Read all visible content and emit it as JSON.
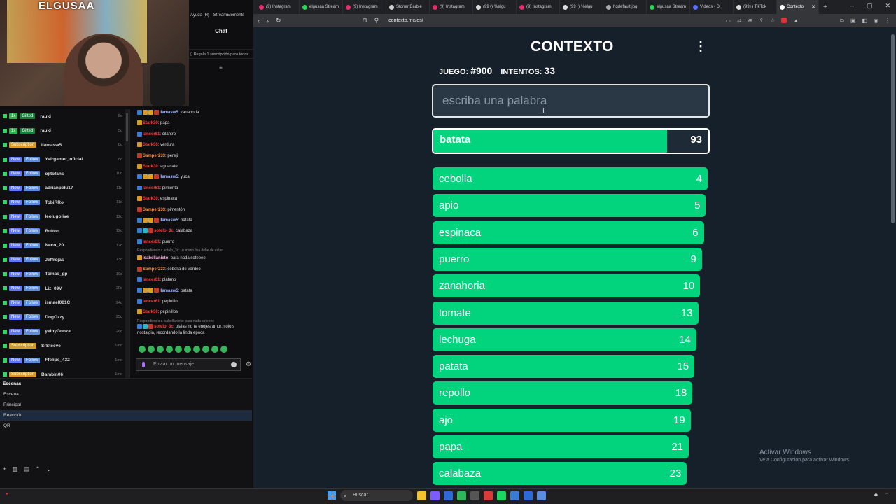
{
  "studio": {
    "webcam_banner": "ELGUSAA",
    "top_menu": [
      "Ayuda (H)",
      "StreamElements"
    ],
    "chat_title": "Chat",
    "gift_note": "Regala 1 suscripción para todos",
    "activity": [
      {
        "badges": [
          [
            "1x",
            "gifted"
          ],
          [
            "Gifted",
            "gift2"
          ]
        ],
        "user": "rauki",
        "ago": "5d"
      },
      {
        "badges": [
          [
            "1x",
            "gifted"
          ],
          [
            "Gifted",
            "gift2"
          ]
        ],
        "user": "rauki",
        "ago": "5d"
      },
      {
        "badges": [
          [
            "Subscription",
            "sub"
          ]
        ],
        "user": "llamasw5",
        "ago": "8d"
      },
      {
        "badges": [
          [
            "New",
            "new"
          ],
          [
            "Follow",
            "follow"
          ]
        ],
        "user": "Yairgamer_oficial",
        "ago": "8d"
      },
      {
        "badges": [
          [
            "New",
            "new"
          ],
          [
            "Follow",
            "follow"
          ]
        ],
        "user": "ojitofans",
        "ago": "10d"
      },
      {
        "badges": [
          [
            "New",
            "new"
          ],
          [
            "Follow",
            "follow"
          ]
        ],
        "user": "adrianpelu17",
        "ago": "11d"
      },
      {
        "badges": [
          [
            "New",
            "new"
          ],
          [
            "Follow",
            "follow"
          ]
        ],
        "user": "TobiRRo",
        "ago": "11d"
      },
      {
        "badges": [
          [
            "New",
            "new"
          ],
          [
            "Follow",
            "follow"
          ]
        ],
        "user": "leolugolive",
        "ago": "12d"
      },
      {
        "badges": [
          [
            "New",
            "new"
          ],
          [
            "Follow",
            "follow"
          ]
        ],
        "user": "Bultoo",
        "ago": "12d"
      },
      {
        "badges": [
          [
            "New",
            "new"
          ],
          [
            "Follow",
            "follow"
          ]
        ],
        "user": "Neco_20",
        "ago": "12d"
      },
      {
        "badges": [
          [
            "New",
            "new"
          ],
          [
            "Follow",
            "follow"
          ]
        ],
        "user": "Jeffrojas",
        "ago": "13d"
      },
      {
        "badges": [
          [
            "New",
            "new"
          ],
          [
            "Follow",
            "follow"
          ]
        ],
        "user": "Tomas_gp",
        "ago": "19d"
      },
      {
        "badges": [
          [
            "New",
            "new"
          ],
          [
            "Follow",
            "follow"
          ]
        ],
        "user": "Liz_09V",
        "ago": "20d"
      },
      {
        "badges": [
          [
            "New",
            "new"
          ],
          [
            "Follow",
            "follow"
          ]
        ],
        "user": "ismael001C",
        "ago": "24d"
      },
      {
        "badges": [
          [
            "New",
            "new"
          ],
          [
            "Follow",
            "follow"
          ]
        ],
        "user": "DogOzzy",
        "ago": "25d"
      },
      {
        "badges": [
          [
            "New",
            "new"
          ],
          [
            "Follow",
            "follow"
          ]
        ],
        "user": "yeinyGonza",
        "ago": "26d"
      },
      {
        "badges": [
          [
            "Subscription",
            "sub"
          ]
        ],
        "user": "SrSteeve",
        "ago": "1mo"
      },
      {
        "badges": [
          [
            "New",
            "new"
          ],
          [
            "Follow",
            "follow"
          ]
        ],
        "user": "Ffelipe_432",
        "ago": "1mo"
      },
      {
        "badges": [
          [
            "Subscription",
            "sub"
          ]
        ],
        "user": "Bambin06",
        "ago": "1mo"
      }
    ],
    "chat": [
      {
        "user": "llamasw5",
        "color": "#9fb3ff",
        "text": "zanahoria",
        "badges": [
          "#3a7bd5",
          "#d79a25",
          "#e0a020",
          "#c0392b"
        ]
      },
      {
        "user": "Stark30",
        "color": "#ff3b3b",
        "text": "papa",
        "badges": [
          "#d79a25"
        ]
      },
      {
        "user": "lancer61",
        "color": "#ff3b3b",
        "text": "cilantro",
        "badges": [
          "#3a7bd5"
        ]
      },
      {
        "user": "Stark30",
        "color": "#ff3b3b",
        "text": "verdura",
        "badges": [
          "#d79a25"
        ]
      },
      {
        "user": "Samper233",
        "color": "#ff8c3b",
        "text": "perejil",
        "badges": [
          "#c0392b"
        ]
      },
      {
        "user": "Stark30",
        "color": "#ff3b3b",
        "text": "aguacate",
        "badges": [
          "#d79a25"
        ]
      },
      {
        "user": "llamasw5",
        "color": "#9fb3ff",
        "text": "yuca",
        "badges": [
          "#3a7bd5",
          "#d79a25",
          "#e0a020",
          "#c0392b"
        ]
      },
      {
        "user": "lancer61",
        "color": "#ff3b3b",
        "text": "pimienta",
        "badges": [
          "#3a7bd5"
        ]
      },
      {
        "user": "Stark30",
        "color": "#ff3b3b",
        "text": "espinaca",
        "badges": [
          "#d79a25"
        ]
      },
      {
        "user": "Samper233",
        "color": "#ff8c3b",
        "text": "pimentón",
        "badges": [
          "#c0392b"
        ]
      },
      {
        "user": "llamasw5",
        "color": "#9fb3ff",
        "text": "batata",
        "badges": [
          "#3a7bd5",
          "#d79a25",
          "#e0a020",
          "#c0392b"
        ]
      },
      {
        "user": "sotelo_3c",
        "color": "#ff3b3b",
        "text": "calabaza",
        "badges": [
          "#3a7bd5",
          "#2fb6c5",
          "#c0392b"
        ]
      },
      {
        "user": "lancer61",
        "color": "#ff3b3b",
        "text": "puerro",
        "badges": [
          "#3a7bd5"
        ]
      },
      {
        "reply": "Respondiendo a sotelo_3c: uy mano lisa debe de estar"
      },
      {
        "user": "isabellanieto",
        "color": "#ffb0e0",
        "text": "para nada soteeee",
        "badges": [
          "#e0a020"
        ]
      },
      {
        "user": "Samper233",
        "color": "#ff8c3b",
        "text": "cebolla de verdeo",
        "badges": [
          "#c0392b"
        ]
      },
      {
        "user": "lancer61",
        "color": "#ff3b3b",
        "text": "plátano",
        "badges": [
          "#3a7bd5"
        ]
      },
      {
        "user": "llamasw5",
        "color": "#9fb3ff",
        "text": "batata",
        "badges": [
          "#3a7bd5",
          "#d79a25",
          "#e0a020",
          "#c0392b"
        ]
      },
      {
        "user": "lancer61",
        "color": "#ff3b3b",
        "text": "pepinillo",
        "badges": [
          "#3a7bd5"
        ]
      },
      {
        "user": "Stark30",
        "color": "#ff3b3b",
        "text": "pepinillos",
        "badges": [
          "#d79a25"
        ]
      },
      {
        "reply": "Respondiendo a isabellanieto: para nada soteeee"
      },
      {
        "user": "sotelo_3c",
        "color": "#ff3b3b",
        "text": "ojalas no te enojes amor, solo s nostalgia, recordando la linda epoca",
        "badges": [
          "#3a7bd5",
          "#2fb6c5",
          "#c0392b"
        ],
        "wrap": true
      }
    ],
    "chat_input_placeholder": "Enviar un mensaje",
    "scenes_title": "Escenas",
    "scenes": [
      "Escena",
      "Principal",
      "Reacción",
      "QR"
    ],
    "active_scene": "Reacción"
  },
  "browser": {
    "tabs": [
      {
        "label": "(9) Instagram",
        "color": "#e1306c"
      },
      {
        "label": "elgusaa Stream",
        "color": "#2fd35a"
      },
      {
        "label": "(9) Instagram",
        "color": "#e1306c"
      },
      {
        "label": "Stoner Barbie",
        "color": "#cccccc"
      },
      {
        "label": "(9) Instagram",
        "color": "#e1306c"
      },
      {
        "label": "(99+) %elgu",
        "color": "#dddddd"
      },
      {
        "label": "(9) Instagram",
        "color": "#e1306c"
      },
      {
        "label": "(99+) %elgu",
        "color": "#dddddd"
      },
      {
        "label": "hqdefault.jpg",
        "color": "#aaaaaa"
      },
      {
        "label": "elgusaa Stream",
        "color": "#2fd35a"
      },
      {
        "label": "Videos • D",
        "color": "#5a6cff"
      },
      {
        "label": "(99+) TikTok",
        "color": "#dddddd"
      },
      {
        "label": "Contexto",
        "color": "#ffffff",
        "active": true
      }
    ],
    "url": "contexto.me/es/"
  },
  "game": {
    "logo": "CONTEXTO",
    "game_label": "JUEGO:",
    "game_number": "#900",
    "attempts_label": "INTENTOS:",
    "attempts": "33",
    "input_placeholder": "escriba una palabra",
    "last_guess": {
      "word": "batata",
      "rank": 93,
      "fill": 0.85
    },
    "guesses": [
      {
        "word": "cebolla",
        "rank": 4
      },
      {
        "word": "apio",
        "rank": 5
      },
      {
        "word": "espinaca",
        "rank": 6
      },
      {
        "word": "puerro",
        "rank": 9
      },
      {
        "word": "zanahoria",
        "rank": 10
      },
      {
        "word": "tomate",
        "rank": 13
      },
      {
        "word": "lechuga",
        "rank": 14
      },
      {
        "word": "patata",
        "rank": 15
      },
      {
        "word": "repollo",
        "rank": 18
      },
      {
        "word": "ajo",
        "rank": 19
      },
      {
        "word": "papa",
        "rank": 21
      },
      {
        "word": "calabaza",
        "rank": 23
      }
    ],
    "watermark_title": "Activar Windows",
    "watermark_sub": "Ve a Configuración para activar Windows."
  },
  "taskbar": {
    "search_label": "Buscar",
    "apps": [
      "#f2c230",
      "#7a5cff",
      "#2c6ad8",
      "#2fb65a",
      "#555555",
      "#d93a3a",
      "#1ed760",
      "#3a7bd5",
      "#2c6ad8",
      "#5a8dde"
    ]
  }
}
